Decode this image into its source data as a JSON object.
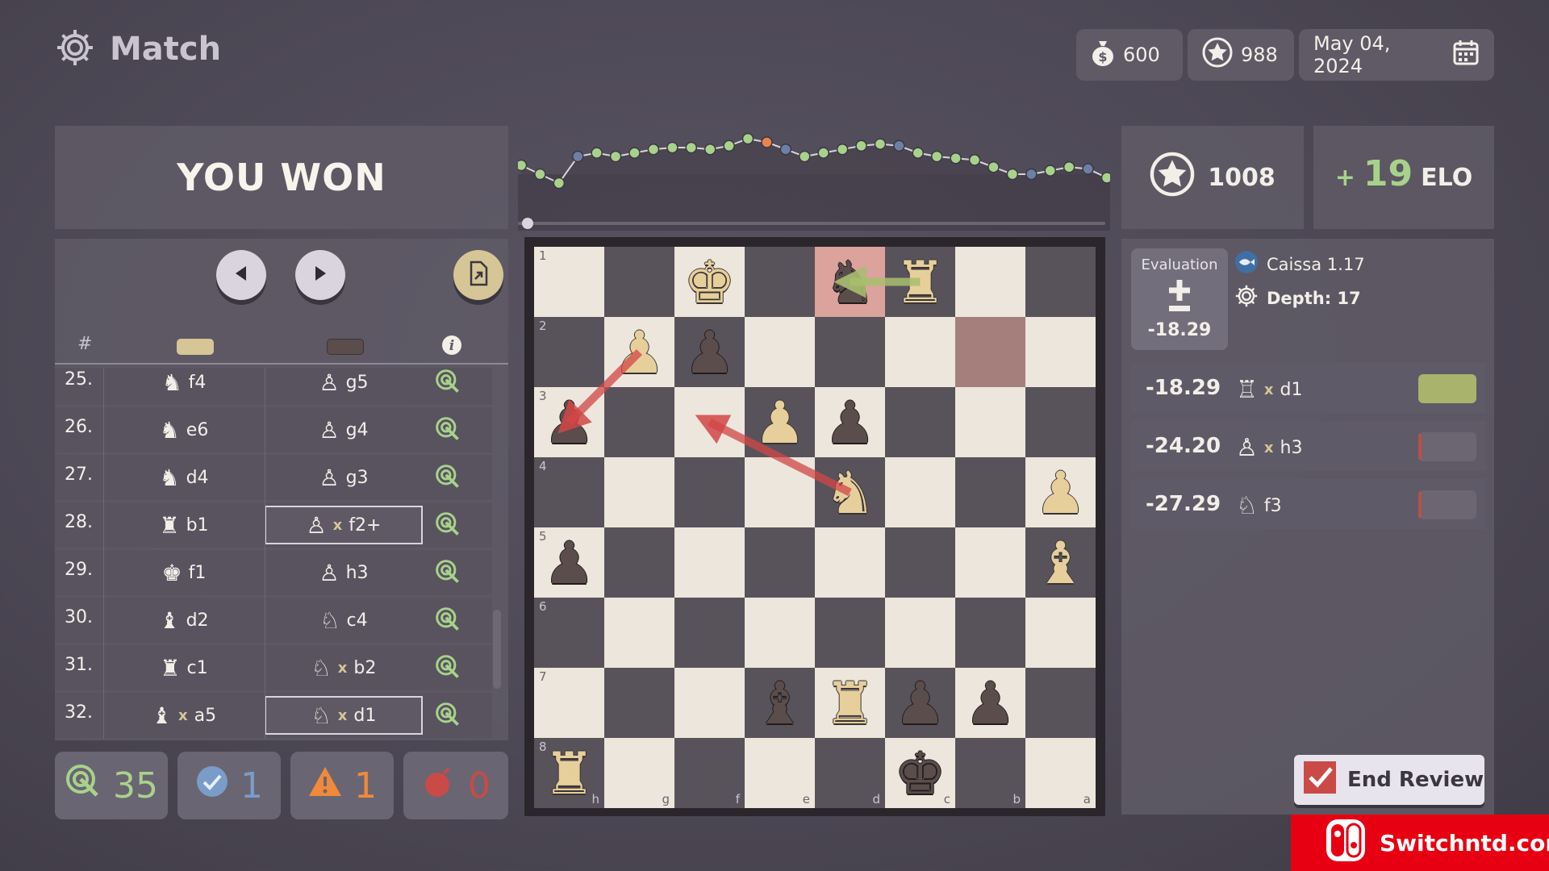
{
  "header": {
    "title": "Match",
    "coins": "600",
    "stars": "988",
    "date": "May 04, 2024"
  },
  "result": {
    "text": "YOU WON"
  },
  "rating": {
    "value": "1008"
  },
  "elo": {
    "sign": "+",
    "change": "19",
    "unit": "ELO"
  },
  "moves": {
    "header_num": "#",
    "rows": [
      {
        "num": "25.",
        "white": {
          "piece": "knight",
          "capture": false,
          "square": "f4"
        },
        "black": {
          "piece": "pawn",
          "capture": false,
          "square": "g5"
        }
      },
      {
        "num": "26.",
        "white": {
          "piece": "knight",
          "capture": false,
          "square": "e6"
        },
        "black": {
          "piece": "pawn",
          "capture": false,
          "square": "g4"
        }
      },
      {
        "num": "27.",
        "white": {
          "piece": "knight",
          "capture": false,
          "square": "d4"
        },
        "black": {
          "piece": "pawn",
          "capture": false,
          "square": "g3"
        }
      },
      {
        "num": "28.",
        "white": {
          "piece": "rook",
          "capture": false,
          "square": "b1"
        },
        "black": {
          "piece": "pawn",
          "capture": true,
          "square": "f2+"
        }
      },
      {
        "num": "29.",
        "white": {
          "piece": "king",
          "capture": false,
          "square": "f1"
        },
        "black": {
          "piece": "pawn",
          "capture": false,
          "square": "h3"
        }
      },
      {
        "num": "30.",
        "white": {
          "piece": "bishop",
          "capture": false,
          "square": "d2"
        },
        "black": {
          "piece": "knight",
          "capture": false,
          "square": "c4"
        }
      },
      {
        "num": "31.",
        "white": {
          "piece": "rook",
          "capture": false,
          "square": "c1"
        },
        "black": {
          "piece": "knight",
          "capture": true,
          "square": "b2"
        }
      },
      {
        "num": "32.",
        "white": {
          "piece": "bishop",
          "capture": true,
          "square": "a5"
        },
        "black": {
          "piece": "knight",
          "capture": true,
          "square": "d1"
        }
      }
    ],
    "capture_mark": "x"
  },
  "summary": {
    "best": "35",
    "good": "1",
    "mistake": "1",
    "blunder": "0"
  },
  "board": {
    "files": [
      "h",
      "g",
      "f",
      "e",
      "d",
      "c",
      "b",
      "a"
    ],
    "ranks": [
      "1",
      "2",
      "3",
      "4",
      "5",
      "6",
      "7",
      "8"
    ],
    "pieces": [
      {
        "sq": "f1",
        "type": "king",
        "color": "white"
      },
      {
        "sq": "d1",
        "type": "knight",
        "color": "black"
      },
      {
        "sq": "c1",
        "type": "rook",
        "color": "white"
      },
      {
        "sq": "g2",
        "type": "pawn",
        "color": "white"
      },
      {
        "sq": "f2",
        "type": "pawn",
        "color": "black"
      },
      {
        "sq": "h3",
        "type": "pawn",
        "color": "black"
      },
      {
        "sq": "e3",
        "type": "pawn",
        "color": "white"
      },
      {
        "sq": "d3",
        "type": "pawn",
        "color": "black"
      },
      {
        "sq": "d4",
        "type": "knight",
        "color": "white"
      },
      {
        "sq": "a4",
        "type": "pawn",
        "color": "white"
      },
      {
        "sq": "h5",
        "type": "pawn",
        "color": "black"
      },
      {
        "sq": "a5",
        "type": "bishop",
        "color": "white"
      },
      {
        "sq": "e7",
        "type": "bishop",
        "color": "black"
      },
      {
        "sq": "d7",
        "type": "rook",
        "color": "white"
      },
      {
        "sq": "c7",
        "type": "pawn",
        "color": "black"
      },
      {
        "sq": "b7",
        "type": "pawn",
        "color": "black"
      },
      {
        "sq": "h8",
        "type": "rook",
        "color": "white"
      },
      {
        "sq": "c8",
        "type": "king",
        "color": "black"
      }
    ],
    "highlight_from": "b2",
    "highlight_to": "d1"
  },
  "analysis": {
    "evaluation_label": "Evaluation",
    "evaluation_value": "-18.29",
    "engine_name": "Caissa 1.17",
    "depth_label": "Depth: 17",
    "lines": [
      {
        "eval": "-18.29",
        "piece": "rook",
        "capture": true,
        "square": "d1",
        "score_fill": 1.0
      },
      {
        "eval": "-24.20",
        "piece": "pawn",
        "capture": true,
        "square": "h3",
        "score_fill": 0.0
      },
      {
        "eval": "-27.29",
        "piece": "knight",
        "capture": false,
        "square": "f3",
        "score_fill": 0.0
      }
    ]
  },
  "graph": {
    "values": [
      0.05,
      0.0,
      -0.05,
      0.1,
      0.12,
      0.1,
      0.12,
      0.14,
      0.15,
      0.15,
      0.14,
      0.16,
      0.2,
      0.18,
      0.14,
      0.1,
      0.12,
      0.14,
      0.16,
      0.17,
      0.16,
      0.12,
      0.1,
      0.09,
      0.08,
      0.04,
      0.0,
      0.0,
      0.02,
      0.04,
      0.03,
      -0.02
    ],
    "scrub_position": 0.0
  },
  "end_review_label": "End Review",
  "watermark_text": "Switchntd.com"
}
